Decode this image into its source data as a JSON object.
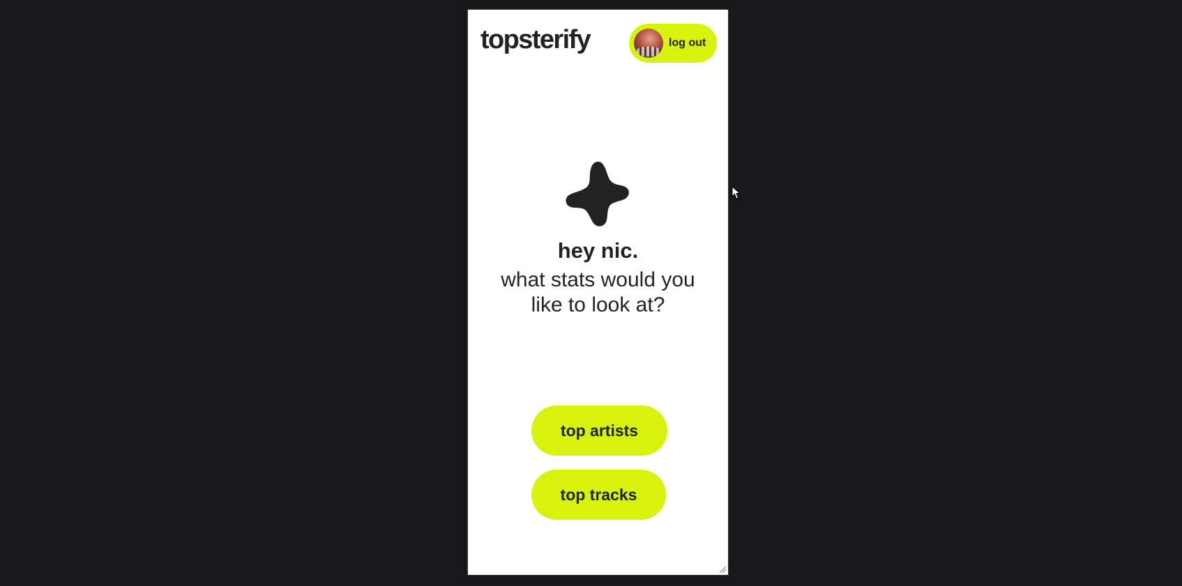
{
  "app": {
    "logo": "topsterify"
  },
  "header": {
    "logout_label": "log out",
    "avatar_icon": "user-avatar"
  },
  "hero": {
    "icon": "star-icon",
    "greeting": "hey nic.",
    "question": "what stats would you like to look at?"
  },
  "actions": {
    "top_artists": "top artists",
    "top_tracks": "top tracks"
  },
  "colors": {
    "background": "#18181b",
    "surface": "#ffffff",
    "accent": "#d7f20d",
    "text": "#222222"
  }
}
